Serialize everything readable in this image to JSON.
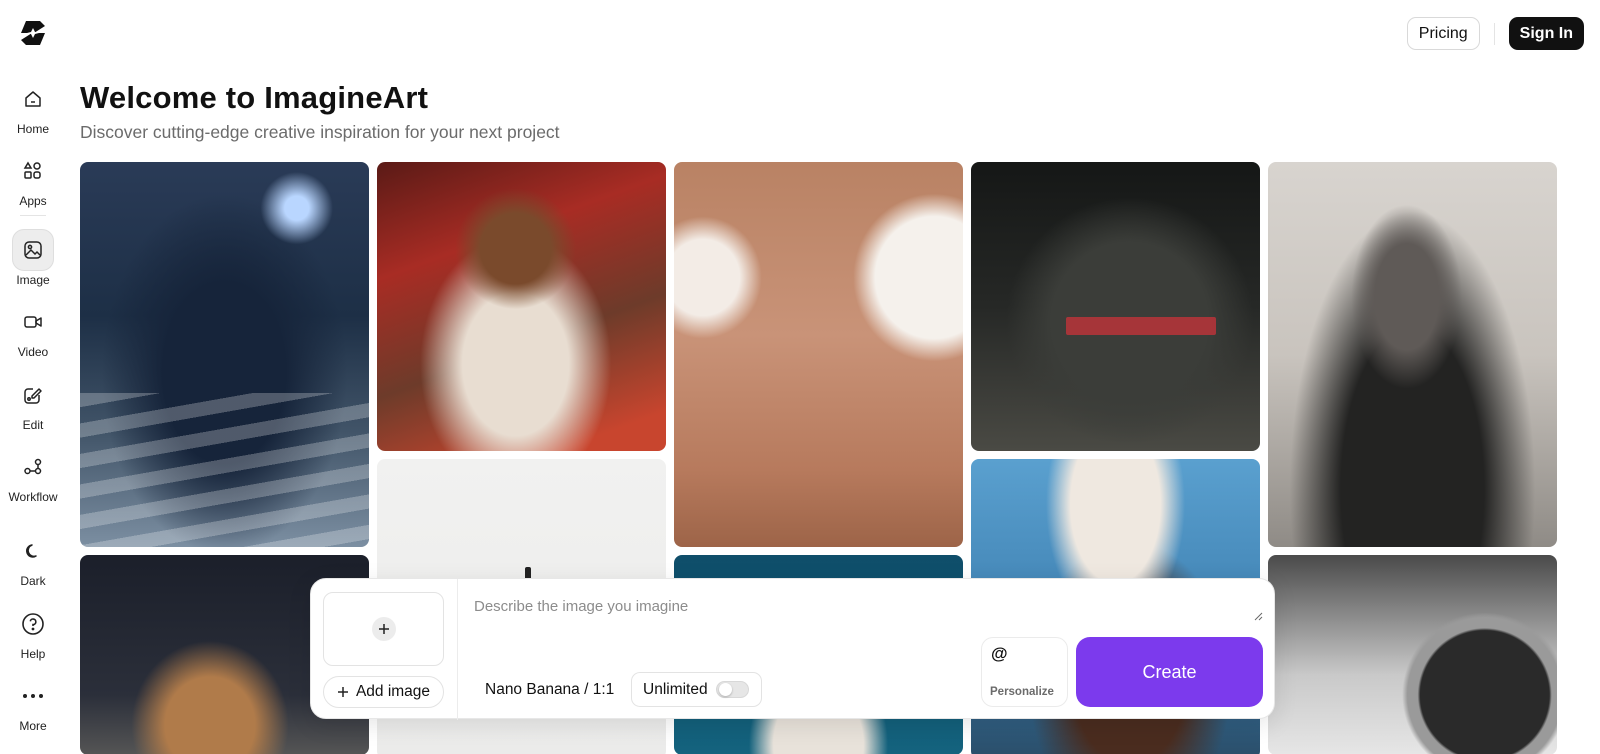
{
  "header": {
    "pricing_label": "Pricing",
    "signin_label": "Sign In"
  },
  "sidebar": {
    "items": [
      {
        "label": "Home",
        "icon": "home-icon"
      },
      {
        "label": "Apps",
        "icon": "apps-icon"
      },
      {
        "label": "Image",
        "icon": "image-icon",
        "active": true
      },
      {
        "label": "Video",
        "icon": "video-icon"
      },
      {
        "label": "Edit",
        "icon": "edit-icon"
      },
      {
        "label": "Workflow",
        "icon": "workflow-icon"
      },
      {
        "label": "Dark",
        "icon": "moon-icon"
      },
      {
        "label": "Help",
        "icon": "help-icon"
      },
      {
        "label": "More",
        "icon": "more-icon"
      }
    ]
  },
  "main": {
    "title": "Welcome to ImagineArt",
    "subtitle": "Discover cutting-edge creative inspiration for your next project"
  },
  "composer": {
    "add_image_label": "Add image",
    "prompt_placeholder": "Describe the image you imagine",
    "model_label": "Nano Banana / 1:1",
    "unlimited_label": "Unlimited",
    "unlimited_on": false,
    "personalize_symbol": "@",
    "personalize_label": "Personalize",
    "create_label": "Create"
  },
  "colors": {
    "accent": "#7c3aed",
    "signin_bg": "#111111"
  }
}
